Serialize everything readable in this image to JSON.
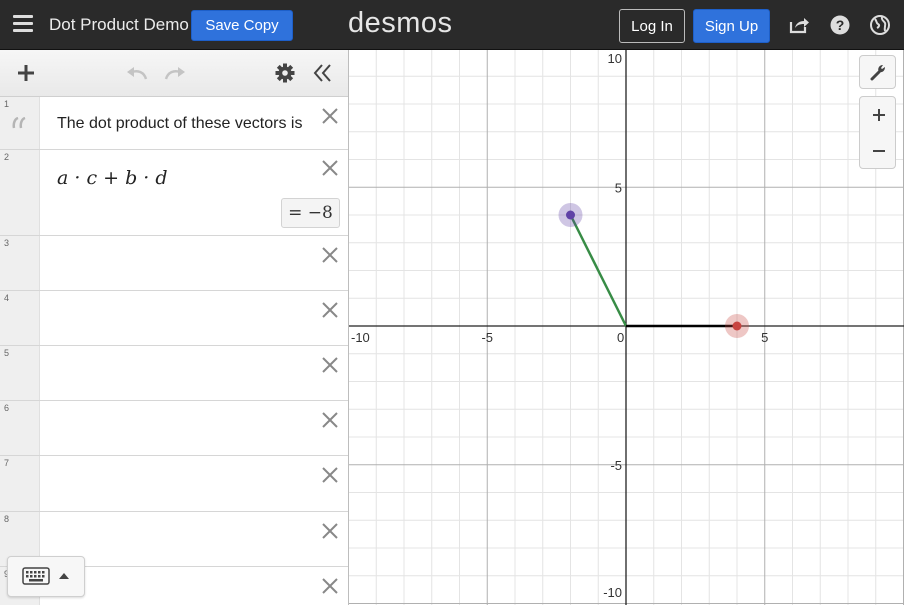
{
  "header": {
    "title": "Dot Product Demo",
    "save_copy": "Save Copy",
    "logo": "desmos",
    "log_in": "Log In",
    "sign_up": "Sign Up",
    "icons": [
      "menu-icon",
      "share-icon",
      "help-icon",
      "globe-icon"
    ]
  },
  "toolbar": {
    "icons": [
      "add-icon",
      "undo-icon",
      "redo-icon",
      "settings-icon",
      "collapse-icon"
    ]
  },
  "expressions": [
    {
      "num": "1",
      "type": "note",
      "icon": "quote-icon",
      "text": "The dot product of these vectors is"
    },
    {
      "num": "2",
      "type": "math",
      "text": "a · c + b · d",
      "result": "= −8"
    },
    {
      "num": "3",
      "type": "empty"
    },
    {
      "num": "4",
      "type": "empty"
    },
    {
      "num": "5",
      "type": "empty"
    },
    {
      "num": "6",
      "type": "empty"
    },
    {
      "num": "7",
      "type": "empty"
    },
    {
      "num": "8",
      "type": "empty"
    },
    {
      "num": "9",
      "type": "empty"
    }
  ],
  "graph": {
    "x_ticks": [
      "-10",
      "-5",
      "0",
      "5"
    ],
    "y_ticks": [
      "10",
      "5",
      "-5",
      "-10"
    ],
    "xlim": [
      -10,
      10
    ],
    "ylim": [
      -10,
      10
    ],
    "vector_purple": {
      "x": -2,
      "y": 4,
      "color": "#6042a6",
      "line_color": "#388c46"
    },
    "vector_red": {
      "x": 4,
      "y": 0,
      "color": "#c74440",
      "line_color": "#000000"
    },
    "zoom_in": "+",
    "zoom_out": "−"
  },
  "colors": {
    "accent": "#2f72dc",
    "topbar": "#2a2a2a"
  }
}
